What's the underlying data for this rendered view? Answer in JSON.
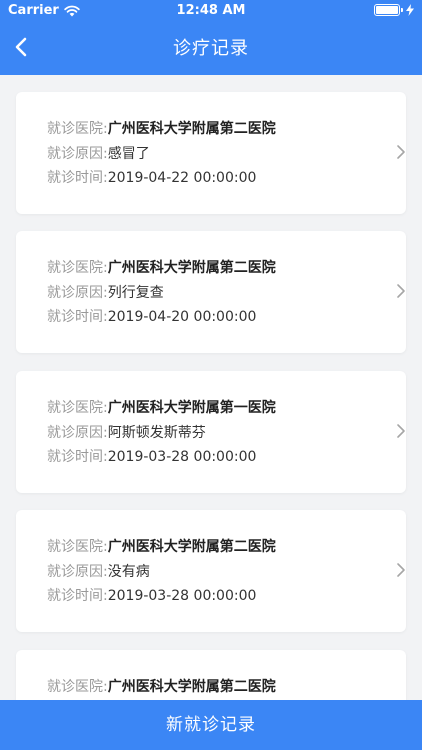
{
  "status_bar": {
    "carrier": "Carrier",
    "time": "12:48 AM"
  },
  "nav": {
    "title": "诊疗记录"
  },
  "labels": {
    "hospital": "就诊医院:",
    "reason": "就诊原因:",
    "time": "就诊时间:"
  },
  "records": [
    {
      "hospital": "广州医科大学附属第二医院",
      "reason": "感冒了",
      "time": "2019-04-22 00:00:00"
    },
    {
      "hospital": "广州医科大学附属第二医院",
      "reason": "列行复查",
      "time": "2019-04-20 00:00:00"
    },
    {
      "hospital": "广州医科大学附属第一医院",
      "reason": "阿斯顿发斯蒂芬",
      "time": "2019-03-28 00:00:00"
    },
    {
      "hospital": "广州医科大学附属第二医院",
      "reason": "没有病",
      "time": "2019-03-28 00:00:00"
    },
    {
      "hospital": "广州医科大学附属第二医院",
      "reason": "",
      "time": ""
    }
  ],
  "bottom": {
    "new_record_label": "新就诊记录"
  },
  "colors": {
    "primary": "#3b86f5",
    "background": "#f2f3f5",
    "card": "#ffffff",
    "label": "#999999",
    "value": "#333333"
  }
}
